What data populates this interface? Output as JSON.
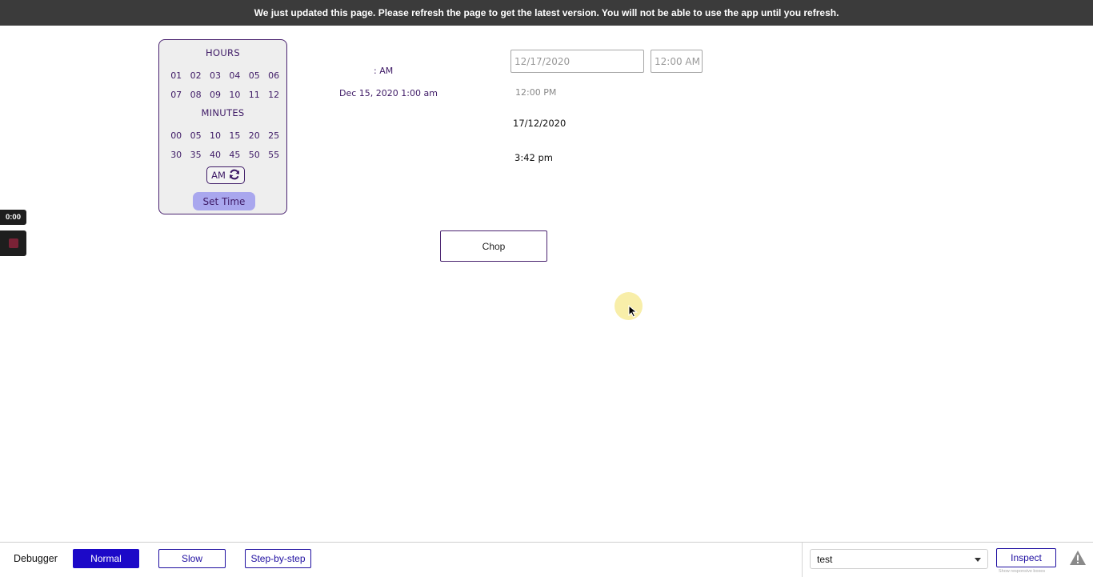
{
  "banner": {
    "message": "We just updated this page. Please refresh the page to get the latest version. You will not be able to use the app until you refresh."
  },
  "time_picker": {
    "hours_title": "HOURS",
    "hours": [
      "01",
      "02",
      "03",
      "04",
      "05",
      "06",
      "07",
      "08",
      "09",
      "10",
      "11",
      "12"
    ],
    "minutes_title": "MINUTES",
    "minutes": [
      "00",
      "05",
      "10",
      "15",
      "20",
      "25",
      "30",
      "35",
      "40",
      "45",
      "50",
      "55"
    ],
    "ampm_label": "AM",
    "ampm_icon": "refresh-icon",
    "set_time_label": "Set Time"
  },
  "middle": {
    "time_output": ": AM",
    "datetime_output": "Dec 15, 2020 1:00 am"
  },
  "right": {
    "date_input_placeholder": "12/17/2020",
    "time_input_placeholder": "12:00 AM",
    "time_text": "12:00 PM",
    "date_text": "17/12/2020",
    "clock_text": "3:42 pm"
  },
  "chop_label": "Chop",
  "recorder": {
    "timer": "0:00",
    "stop_icon": "stop-icon"
  },
  "colors": {
    "accent": "#3e1a66",
    "picker_bg": "#eeeeee",
    "set_time_bg": "#a9a7ee",
    "debugger_active": "#1c09c8",
    "banner_bg": "#3b3b3b"
  },
  "debugger": {
    "label": "Debugger",
    "modes": [
      {
        "label": "Normal",
        "active": true
      },
      {
        "label": "Slow",
        "active": false
      },
      {
        "label": "Step-by-step",
        "active": false
      }
    ],
    "select_value": "test",
    "inspect_label": "Inspect",
    "responsive_note": "Show responsive boxes",
    "warning_icon": "warning-icon"
  }
}
